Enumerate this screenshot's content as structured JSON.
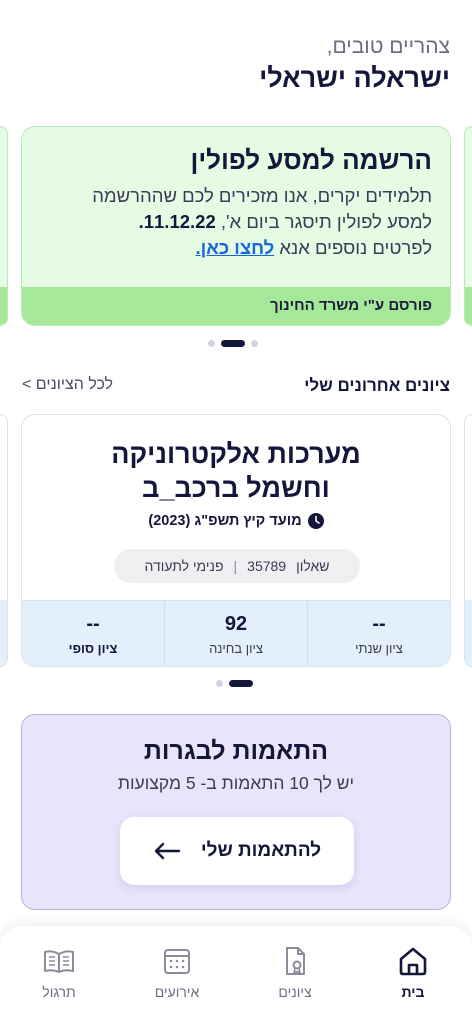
{
  "greeting": {
    "subtitle": "צהריים טובים,",
    "name": "ישראלה ישראלי"
  },
  "announcement": {
    "title": "הרשמה למסע לפולין",
    "body_line1": "תלמידים יקרים, אנו מזכירים לכם שההרשמה",
    "body_line2_prefix": "למסע לפולין תיסגר ביום א', ",
    "body_line2_date": "11.12.22.",
    "body_line3_prefix": "לפרטים נוספים אנא ",
    "link_label": "לחצו כאן.",
    "footer": "פורסם ע\"י משרד החינוך",
    "colors": {
      "background": "#e6fbe4",
      "footer": "#a6e89a",
      "link": "#1668d9"
    }
  },
  "grades": {
    "section_title": "ציונים אחרונים שלי",
    "all_link": "לכל הציונים >",
    "card": {
      "subject_line1": "מערכות אלקטרוניקה",
      "subject_line2": "וחשמל ברכב_ב",
      "session": "מועד קיץ תשפ\"ג (2023)",
      "exam_label": "שאלון",
      "exam_number": "35789",
      "exam_type": "פנימי לתעודה",
      "annual_value": "--",
      "annual_label": "ציון שנתי",
      "exam_value": "92",
      "exam_grade_label": "ציון בחינה",
      "final_value": "--",
      "final_label": "ציון סופי"
    },
    "colors": {
      "grade_row": "#e3f0fb"
    }
  },
  "matches": {
    "title": "התאמות לבגרות",
    "subtitle": "יש לך 10 התאמות ב- 5 מקצועות",
    "button_label": "להתאמות שלי",
    "colors": {
      "background": "#e9e4fb",
      "border": "#b9aee8"
    }
  },
  "nav": {
    "home": "בית",
    "grades": "ציונים",
    "events": "אירועים",
    "practice": "תרגול",
    "active": "home"
  },
  "carousels": {
    "announcements": {
      "count": 3,
      "active_index": 1
    },
    "grades": {
      "count": 2,
      "active_index": 0
    }
  }
}
